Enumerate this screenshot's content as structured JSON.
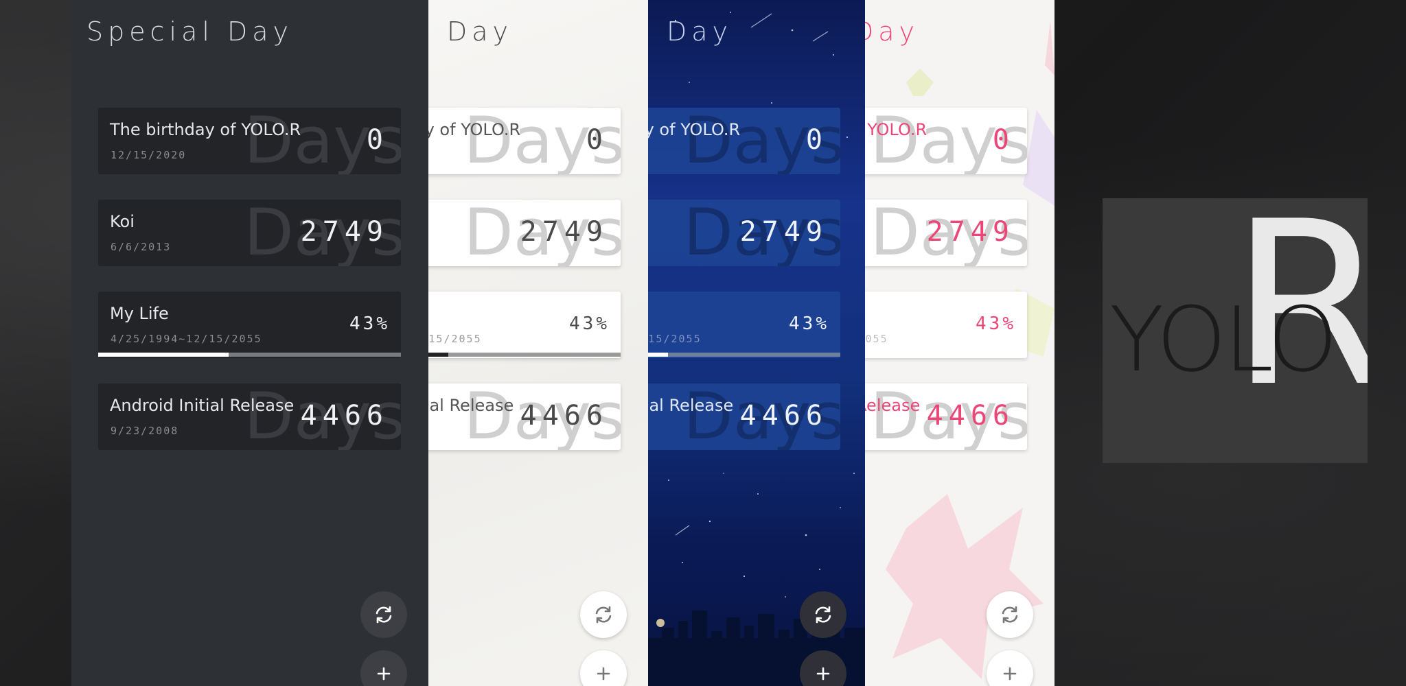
{
  "app": {
    "title": "Special Day"
  },
  "cards": [
    {
      "title": "The birthday of YOLO.R",
      "date": "12/15/2020",
      "value": "0",
      "watermark": "Days"
    },
    {
      "title": "Koi",
      "date": "6/6/2013",
      "value": "2749",
      "watermark": "Days"
    },
    {
      "title": "My Life",
      "date": "4/25/1994~12/15/2055",
      "value": "43%",
      "progress": 0.43
    },
    {
      "title": "Android Initial Release",
      "date": "9/23/2008",
      "value": "4466",
      "watermark": "Days"
    }
  ],
  "themes": [
    {
      "name": "dark",
      "accent": "#2d3035"
    },
    {
      "name": "paper",
      "accent": "#f7f6f4"
    },
    {
      "name": "night-sky",
      "accent": "#16328a"
    },
    {
      "name": "pink-stars",
      "accent": "#ec4677"
    }
  ],
  "fabs": {
    "refresh_icon": "refresh-icon",
    "add_icon": "plus-icon"
  },
  "logo": {
    "word": "YOLO",
    "letter": "R"
  }
}
